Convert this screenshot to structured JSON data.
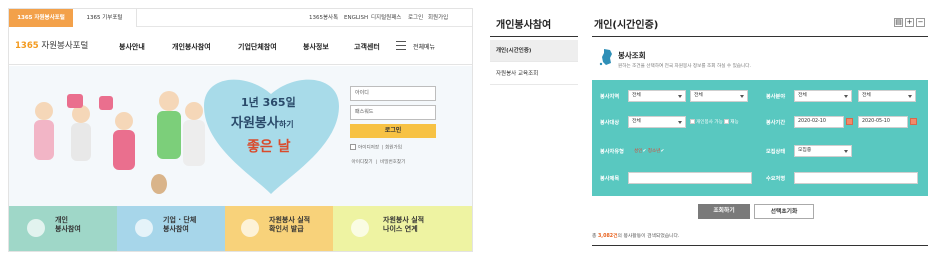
{
  "portal": {
    "tabs": [
      "1365 자원봉사포털",
      "1365 기부포털"
    ],
    "utility_links": [
      "1365봉사톡",
      "ENGLISH",
      "디지털원패스",
      "로그인",
      "회원가입"
    ],
    "logo": {
      "number": "1365",
      "text": "자원봉사포털"
    },
    "nav": [
      "봉사안내",
      "개인봉사참여",
      "기업단체참여",
      "봉사정보",
      "고객센터",
      "전체메뉴"
    ],
    "hero": {
      "line1": "1년",
      "line1_num": "365일",
      "line2": "자원봉사",
      "line2_small": "하기",
      "line3": "좋은 날"
    },
    "login": {
      "id_placeholder": "아이디",
      "pw_placeholder": "패스워드",
      "button": "로그인",
      "save_id": "아이디저장",
      "join": "회원가입",
      "find_id": "아이디찾기",
      "find_pw": "비밀번호찾기"
    },
    "quick_menu": [
      {
        "line1": "개인",
        "line2": "봉사참여"
      },
      {
        "line1": "기업 · 단체",
        "line2": "봉사참여"
      },
      {
        "line1": "자원봉사 실적",
        "line2": "확인서 발급"
      },
      {
        "line1": "자원봉사 실적",
        "line2": "나이스 연계"
      }
    ]
  },
  "sidebar": {
    "title": "개인봉사참여",
    "items": [
      "개인(시간인증)",
      "자원봉사 교육조회"
    ]
  },
  "main": {
    "title": "개인(시간인증)",
    "controls": [
      "▤",
      "+",
      "−"
    ],
    "search": {
      "heading": "봉사조회",
      "description": "원하는 조건을 선택하여 전국 자원봉사 정보를 조회 하실 수 있습니다."
    },
    "form": {
      "region": {
        "label": "봉사지역",
        "sel1": "전체",
        "sel2": "전체"
      },
      "field": {
        "label": "봉사분야",
        "sel1": "전체",
        "sel2": "전체"
      },
      "target": {
        "label": "봉사대상",
        "sel": "전체",
        "opt1": "개인봉사 가능",
        "opt2": "재능"
      },
      "period": {
        "label": "봉사기간",
        "from": "2020-02-10",
        "to": "2020-05-10"
      },
      "type": {
        "label": "봉사자유형",
        "opt1": "성인",
        "opt2": "청소년"
      },
      "status": {
        "label": "모집상태",
        "sel": "모집중"
      },
      "title": {
        "label": "봉사제목",
        "value": ""
      },
      "org": {
        "label": "수요처명",
        "value": ""
      }
    },
    "buttons": {
      "search": "조회하기",
      "reset": "선택초기화"
    },
    "result": {
      "prefix": "총 ",
      "count": "3,082건",
      "suffix": "의 봉사활동이 검색되었습니다."
    }
  },
  "colors": {
    "accent": "#f3a14a",
    "form_bg": "#59c8c0",
    "count": "#e8621f"
  }
}
